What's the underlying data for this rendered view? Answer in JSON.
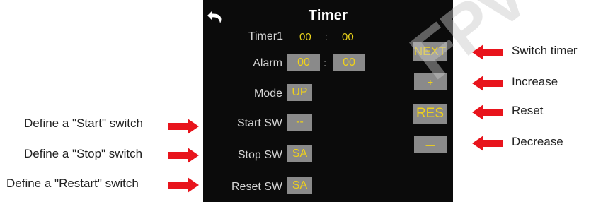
{
  "screen": {
    "title": "Timer",
    "timer1": {
      "label": "Timer1",
      "minutes": "00",
      "separator": ":",
      "seconds": "00"
    },
    "alarm": {
      "label": "Alarm",
      "minutes": "00",
      "separator": ":",
      "seconds": "00"
    },
    "mode": {
      "label": "Mode",
      "value": "UP"
    },
    "start_sw": {
      "label": "Start SW",
      "value": "--"
    },
    "stop_sw": {
      "label": "Stop SW",
      "value": "SA"
    },
    "reset_sw": {
      "label": "Reset SW",
      "value": "SA"
    },
    "buttons": {
      "next": "NEXT",
      "plus": "+",
      "res": "RES",
      "minus": "—"
    }
  },
  "annotations": {
    "left": [
      "Define a \"Start\" switch",
      "Define a \"Stop\" switch",
      "Define a \"Restart\" switch"
    ],
    "right": [
      "Switch timer",
      "Increase",
      "Reset",
      "Decrease"
    ]
  },
  "colors": {
    "screen_bg": "#0b0b0b",
    "button_bg": "#8a8a8a",
    "value_yellow": "#f0d21a",
    "arrow_red": "#e8141c"
  },
  "icons": {
    "back": "back-arrow-icon",
    "pointer": "red-arrow-icon"
  }
}
